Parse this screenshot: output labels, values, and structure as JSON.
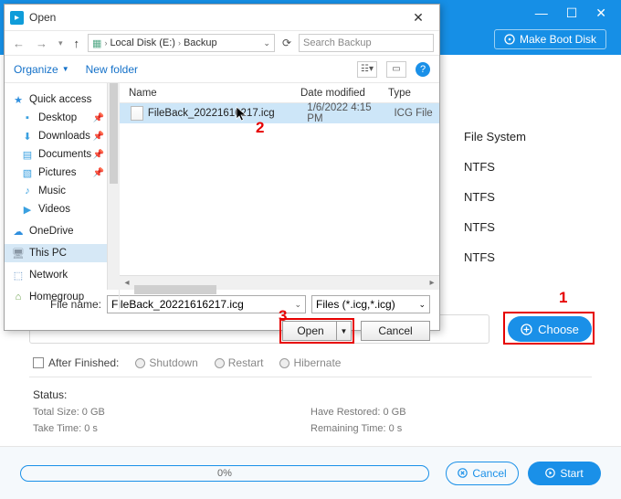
{
  "app_header": {
    "min": "—",
    "max": "☐",
    "close": "✕",
    "boot_disk": "Make Boot Disk"
  },
  "fs": {
    "title": "File System",
    "items": [
      "NTFS",
      "NTFS",
      "NTFS",
      "NTFS"
    ]
  },
  "choose": {
    "btn": "Choose"
  },
  "after": {
    "label": "After Finished:",
    "opt1": "Shutdown",
    "opt2": "Restart",
    "opt3": "Hibernate"
  },
  "status": {
    "title": "Status:",
    "total": "Total Size: 0 GB",
    "restored": "Have Restored: 0 GB",
    "take": "Take Time: 0 s",
    "remain": "Remaining Time: 0 s"
  },
  "footer": {
    "progress": "0%",
    "cancel": "Cancel",
    "start": "Start"
  },
  "dlg": {
    "title": "Open",
    "crumb1": "Local Disk (E:)",
    "crumb2": "Backup",
    "search_ph": "Search Backup",
    "organize": "Organize",
    "newfolder": "New folder",
    "cols": {
      "name": "Name",
      "mod": "Date modified",
      "type": "Type"
    },
    "nav": {
      "quick": "Quick access",
      "items": [
        "Desktop",
        "Downloads",
        "Documents",
        "Pictures",
        "Music",
        "Videos"
      ],
      "onedrive": "OneDrive",
      "thispc": "This PC",
      "network": "Network",
      "homegroup": "Homegroup"
    },
    "file": {
      "name": "FileBack_20221616217.icg",
      "mod": "1/6/2022 4:15 PM",
      "type": "ICG File"
    },
    "filename_label": "File name:",
    "filename_value": "FileBack_20221616217.icg",
    "filter": "Files (*.icg,*.icg)",
    "open": "Open",
    "cancel": "Cancel"
  },
  "anno": {
    "n1": "1",
    "n2": "2",
    "n3": "3"
  }
}
